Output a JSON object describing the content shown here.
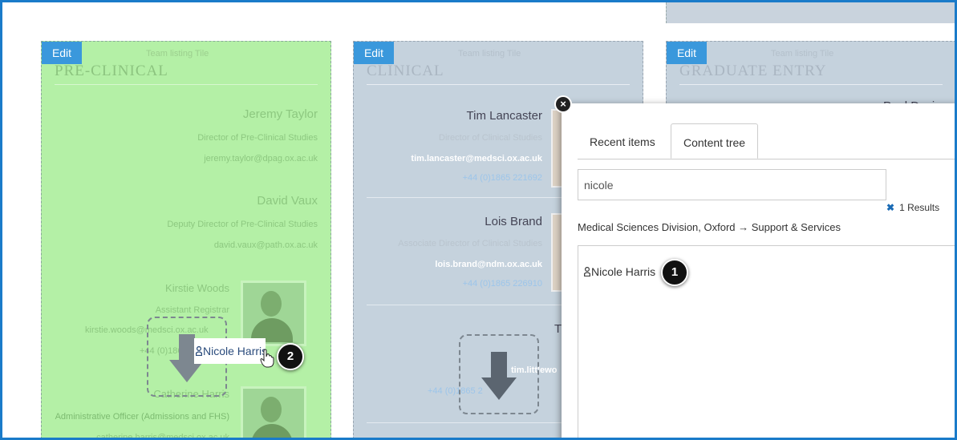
{
  "columns": [
    {
      "edit_label": "Edit",
      "tile_label": "Team listing Tile",
      "title": "PRE-CLINICAL",
      "people": [
        {
          "name": "Jeremy Taylor",
          "role": "Director of Pre-Clinical Studies",
          "email": "jeremy.taylor@dpag.ox.ac.uk"
        },
        {
          "name": "David Vaux",
          "role": "Deputy Director of Pre-Clinical Studies",
          "email": "david.vaux@path.ox.ac.uk"
        },
        {
          "name": "Kirstie Woods",
          "role": "Assistant Registrar",
          "email": "kirstie.woods@medsci.ox.ac.uk",
          "phone": "+44 (0)1865"
        },
        {
          "name": "Catherine Harris",
          "role": "Administrative Officer (Admissions and FHS)",
          "email": "catherine.harris@medsci.ox.ac.uk"
        }
      ]
    },
    {
      "edit_label": "Edit",
      "tile_label": "Team listing Tile",
      "title": "CLINICAL",
      "people": [
        {
          "name": "Tim Lancaster",
          "role": "Director of Clinical Studies",
          "email": "tim.lancaster@medsci.ox.ac.uk",
          "phone": "+44 (0)1865 221692"
        },
        {
          "name": "Lois Brand",
          "role": "Associate Director of Clinical Studies",
          "email": "lois.brand@ndm.ox.ac.uk",
          "phone": "+44 (0)1865 226910"
        },
        {
          "name": "T",
          "email": "tim.littlewo",
          "phone": "+44 (0)1865 2"
        }
      ]
    },
    {
      "edit_label": "Edit",
      "tile_label": "Team listing Tile",
      "title": "GRADUATE ENTRY",
      "people": [
        {
          "name": "Paul Davies"
        }
      ]
    }
  ],
  "drag": {
    "item_label": "Nicole Harris",
    "step": "2"
  },
  "panel": {
    "close_icon": "×",
    "tabs": [
      {
        "label": "Recent items",
        "active": false
      },
      {
        "label": "Content tree",
        "active": true
      }
    ],
    "search_value": "nicole",
    "results_count": "1 Results",
    "clear_icon": "✖",
    "breadcrumb": "Medical Sciences Division, Oxford → Support & Services",
    "result_item": "Nicole Harris",
    "step": "1"
  },
  "colors": {
    "accent": "#3a98dc",
    "frame": "#1a7bc9",
    "highlight_green": "#b4f0a6",
    "tile_blue": "#c5d2dd"
  }
}
